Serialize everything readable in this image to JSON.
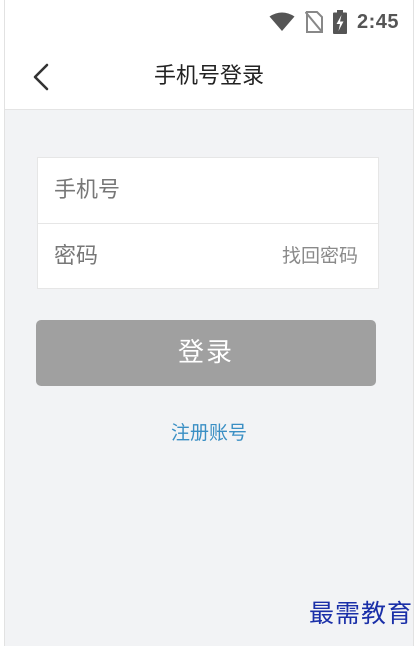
{
  "status_bar": {
    "time": "2:45",
    "icons": [
      "wifi-icon",
      "no-sim-icon",
      "battery-charging-icon"
    ]
  },
  "nav": {
    "back_icon": "chevron-left-icon",
    "title": "手机号登录"
  },
  "form": {
    "phone_placeholder": "手机号",
    "phone_value": "",
    "password_placeholder": "密码",
    "password_value": "",
    "forgot_password": "找回密码"
  },
  "actions": {
    "login_label": "登录",
    "register_label": "注册账号"
  },
  "watermark": "最需教育",
  "colors": {
    "login_button_disabled": "#a0a0a0",
    "link_blue": "#3a8fc4",
    "background": "#f2f3f5",
    "watermark": "#1a2fa8"
  }
}
